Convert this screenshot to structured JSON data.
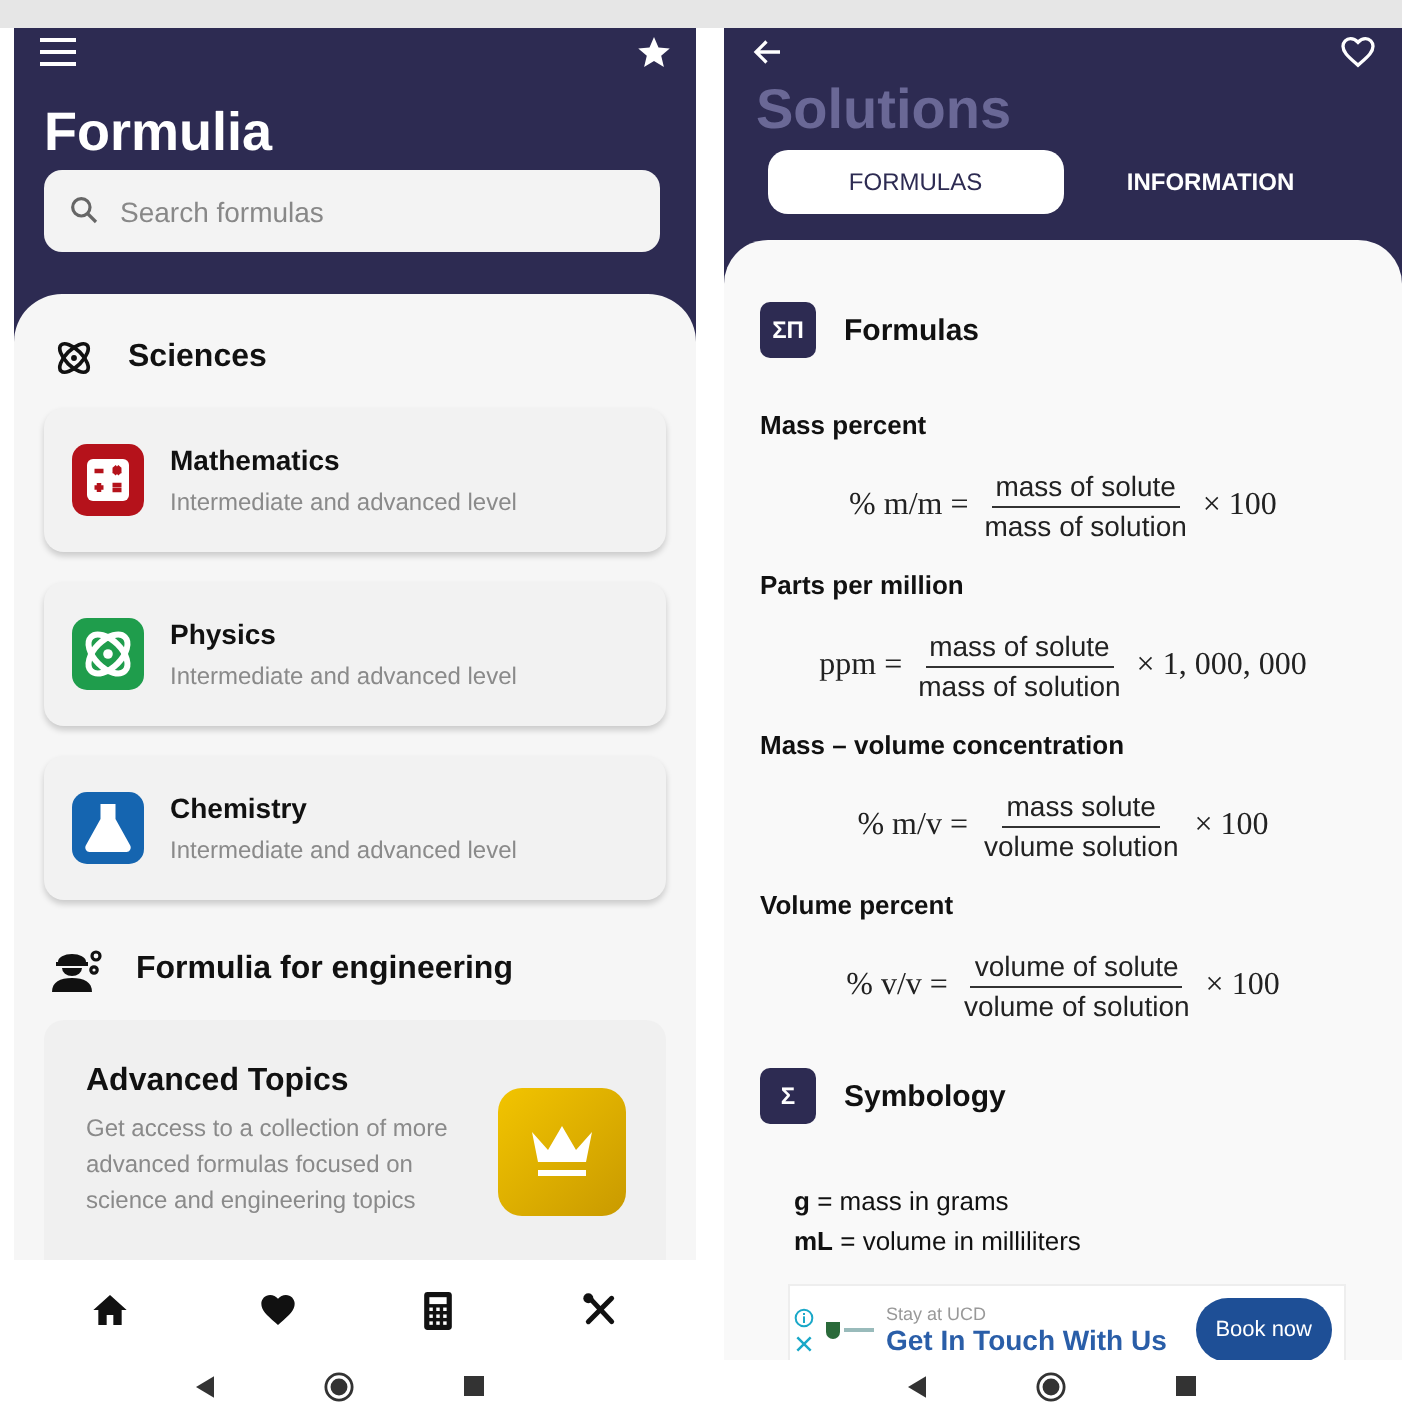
{
  "left_screen": {
    "title": "Formulia",
    "search": {
      "placeholder": "Search formulas"
    },
    "sciences": {
      "heading": "Sciences",
      "items": [
        {
          "name": "Mathematics",
          "subtitle": "Intermediate and advanced level",
          "color": "#b5121b"
        },
        {
          "name": "Physics",
          "subtitle": "Intermediate and advanced level",
          "color": "#1f9d4c"
        },
        {
          "name": "Chemistry",
          "subtitle": "Intermediate and advanced level",
          "color": "#1565b0"
        }
      ]
    },
    "engineering": {
      "heading": "Formulia for engineering",
      "promo": {
        "title": "Advanced Topics",
        "text": "Get access to a collection of more advanced formulas focused on science and engineering topics"
      }
    }
  },
  "right_screen": {
    "title": "Solutions",
    "tabs": [
      {
        "label": "FORMULAS",
        "selected": true
      },
      {
        "label": "INFORMATION",
        "selected": false
      }
    ],
    "formulas_section": {
      "badge": "ΣΠ",
      "heading": "Formulas",
      "formulas": [
        {
          "label": "Mass percent",
          "lhs": "% m/m =",
          "numerator": "mass of solute",
          "denominator": "mass of solution",
          "factor": "× 100"
        },
        {
          "label": "Parts per million",
          "lhs": "ppm =",
          "numerator": "mass of solute",
          "denominator": "mass of solution",
          "factor": "× 1, 000, 000"
        },
        {
          "label": "Mass – volume concentration",
          "lhs": "% m/v =",
          "numerator": "mass solute",
          "denominator": "volume solution",
          "factor": "× 100"
        },
        {
          "label": "Volume percent",
          "lhs": "% v/v =",
          "numerator": "volume of solute",
          "denominator": "volume of solution",
          "factor": "× 100"
        }
      ]
    },
    "symbology": {
      "badge": "Σ",
      "heading": "Symbology",
      "lines": [
        "**g** = mass in grams",
        "**mL** = volume in milliliters"
      ]
    },
    "ad": {
      "eyebrow": "Stay at UCD",
      "headline": "Get In Touch With Us",
      "button": "Book now"
    }
  }
}
